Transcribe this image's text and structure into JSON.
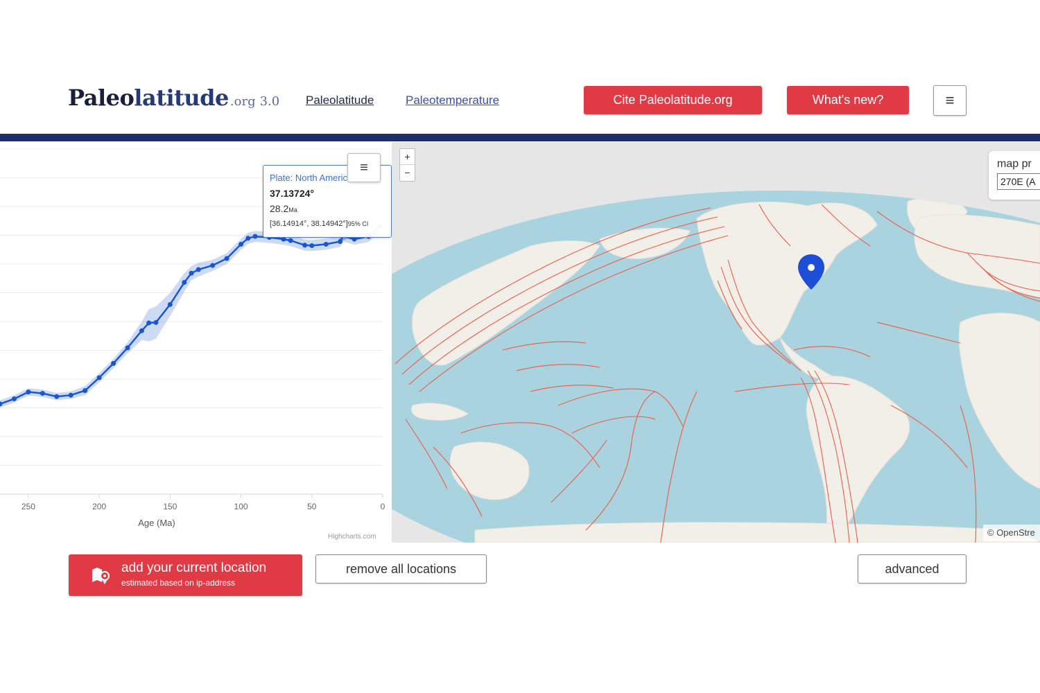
{
  "header": {
    "logo_bold1": "Paleo",
    "logo_bold2": "latitude",
    "logo_tld": ".org",
    "logo_version": "3.0",
    "nav": [
      {
        "label": "Paleolatitude"
      },
      {
        "label": "Paleotemperature"
      }
    ],
    "cite_label": "Cite Paleolatitude.org",
    "whats_new_label": "What's new?",
    "menu_icon": "≡"
  },
  "chart_data": {
    "type": "line",
    "title": "",
    "xlabel": "Age (Ma)",
    "ylabel": "",
    "x_ticks": [
      "250",
      "200",
      "150",
      "100",
      "50",
      "0"
    ],
    "xlim": [
      270,
      0
    ],
    "reversed_x": true,
    "grid": true,
    "series": [
      {
        "x": [
          270,
          260,
          250,
          240,
          230,
          220,
          210,
          200,
          190,
          180,
          170,
          165,
          160,
          150,
          140,
          135,
          130,
          120,
          110,
          100,
          95,
          90,
          80,
          70,
          65,
          55,
          50,
          40,
          30,
          28,
          20,
          10,
          2
        ],
        "y": [
          -10.4,
          -9.3,
          -7.8,
          -8.1,
          -8.8,
          -8.5,
          -7.5,
          -4.7,
          -1.6,
          1.8,
          5.5,
          7.2,
          7.3,
          11.2,
          16.0,
          18.0,
          18.8,
          19.7,
          21.2,
          24.3,
          25.6,
          26.0,
          25.8,
          25.4,
          25.1,
          24.1,
          24.0,
          24.3,
          24.9,
          26.0,
          25.4,
          26.0,
          28.1
        ],
        "band_low": [
          -11.2,
          -10.1,
          -8.6,
          -8.9,
          -9.6,
          -9.3,
          -8.5,
          -5.7,
          -2.6,
          0.6,
          3.5,
          3.2,
          3.8,
          8.7,
          14.0,
          16.5,
          17.3,
          18.5,
          20.0,
          23.1,
          24.4,
          24.8,
          24.6,
          24.2,
          23.9,
          22.9,
          22.8,
          23.1,
          23.7,
          24.9,
          24.2,
          24.8,
          27.0
        ],
        "band_high": [
          -9.6,
          -8.5,
          -7.0,
          -7.3,
          -8.0,
          -7.7,
          -6.5,
          -3.7,
          -0.6,
          3.0,
          7.5,
          10.2,
          10.8,
          13.7,
          18.0,
          19.5,
          20.3,
          20.9,
          22.4,
          25.5,
          26.8,
          27.2,
          27.0,
          26.6,
          26.3,
          25.3,
          25.2,
          25.5,
          26.1,
          27.1,
          26.6,
          27.2,
          29.2
        ]
      }
    ],
    "ylim": [
      -30,
      45
    ],
    "highlight_index": 29
  },
  "tooltip": {
    "plate": "Plate: North America",
    "value": "37.13724°",
    "age": "28.2",
    "age_unit": "Ma",
    "ci": "[36.14914°, 38.14942°]",
    "ci_unit": "95% CI"
  },
  "chart_menu_icon": "≡",
  "chart_credit": "Highcharts.com",
  "map": {
    "zoom_in": "+",
    "zoom_out": "−",
    "projection_label": "map pr",
    "projection_value": "270E (A",
    "attribution": "© OpenStre",
    "ocean_color": "#a9d3df",
    "land_color": "#f2efe9",
    "boundary_color": "#ef5a45",
    "marker_color": "#1d4fd6"
  },
  "controls": {
    "add_location_label": "add your current location",
    "add_location_sub": "estimated based on ip-address",
    "remove_label": "remove all locations",
    "advanced_label": "advanced"
  },
  "colors": {
    "brand_navy": "#1c2e6b",
    "accent_red": "#e03a45",
    "series_blue": "#1a56cf"
  }
}
